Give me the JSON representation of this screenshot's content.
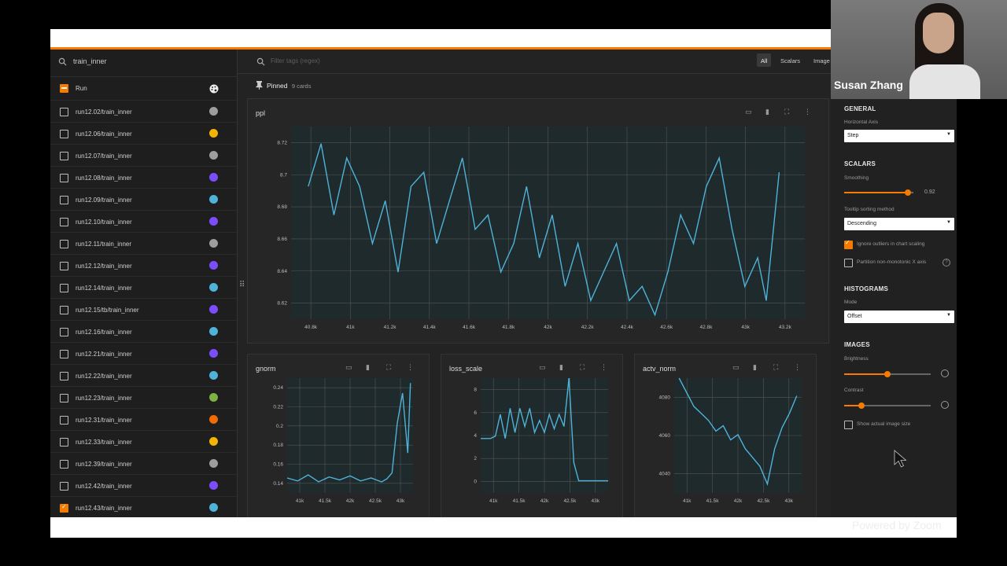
{
  "sidebar": {
    "search_value": "train_inner",
    "header_label": "Run",
    "runs": [
      {
        "label": "run12.02/train_inner",
        "color": "#9e9e9e",
        "checked": false
      },
      {
        "label": "run12.06/train_inner",
        "color": "#f4b400",
        "checked": false
      },
      {
        "label": "run12.07/train_inner",
        "color": "#9e9e9e",
        "checked": false
      },
      {
        "label": "run12.08/train_inner",
        "color": "#7c4dff",
        "checked": false
      },
      {
        "label": "run12.09/train_inner",
        "color": "#4fb3d9",
        "checked": false
      },
      {
        "label": "run12.10/train_inner",
        "color": "#7c4dff",
        "checked": false
      },
      {
        "label": "run12.11/train_inner",
        "color": "#9e9e9e",
        "checked": false
      },
      {
        "label": "run12.12/train_inner",
        "color": "#7c4dff",
        "checked": false
      },
      {
        "label": "run12.14/train_inner",
        "color": "#4fb3d9",
        "checked": false
      },
      {
        "label": "run12.15/tb/train_inner",
        "color": "#7c4dff",
        "checked": false
      },
      {
        "label": "run12.16/train_inner",
        "color": "#4fb3d9",
        "checked": false
      },
      {
        "label": "run12.21/train_inner",
        "color": "#7c4dff",
        "checked": false
      },
      {
        "label": "run12.22/train_inner",
        "color": "#4fb3d9",
        "checked": false
      },
      {
        "label": "run12.23/train_inner",
        "color": "#7cb342",
        "checked": false
      },
      {
        "label": "run12.31/train_inner",
        "color": "#ef6c00",
        "checked": false
      },
      {
        "label": "run12.33/train_inner",
        "color": "#f4b400",
        "checked": false
      },
      {
        "label": "run12.39/train_inner",
        "color": "#9e9e9e",
        "checked": false
      },
      {
        "label": "run12.42/train_inner",
        "color": "#7c4dff",
        "checked": false
      },
      {
        "label": "run12.43/train_inner",
        "color": "#4fb3d9",
        "checked": true
      }
    ]
  },
  "toolbar": {
    "filter_placeholder": "Filter tags (regex)",
    "tabs": [
      "All",
      "Scalars",
      "Image"
    ]
  },
  "pinned": {
    "label": "Pinned",
    "count": "9 cards"
  },
  "chart_data": [
    {
      "type": "line",
      "title": "ppl",
      "xticks": [
        "40.8k",
        "41k",
        "41.2k",
        "41.4k",
        "41.6k",
        "41.8k",
        "42k",
        "42.2k",
        "42.4k",
        "42.6k",
        "42.8k",
        "43k",
        "43.2k"
      ],
      "yticks": [
        "8.72",
        "8.7",
        "8.68",
        "8.66",
        "8.64",
        "8.62"
      ],
      "xlim": [
        40800,
        43200
      ],
      "ylim": [
        8.607,
        8.742
      ],
      "series": [
        {
          "color": "#4fb3d9",
          "x": [
            40880,
            40940,
            41000,
            41060,
            41120,
            41180,
            41240,
            41300,
            41360,
            41420,
            41480,
            41540,
            41600,
            41660,
            41720,
            41780,
            41840,
            41900,
            41960,
            42020,
            42080,
            42140,
            42200,
            42260,
            42320,
            42380,
            42440,
            42500,
            42560,
            42620,
            42680,
            42740,
            42800,
            42860,
            42920,
            42980,
            43020,
            43080
          ],
          "y": [
            8.7,
            8.73,
            8.68,
            8.72,
            8.7,
            8.66,
            8.69,
            8.64,
            8.7,
            8.71,
            8.66,
            8.69,
            8.72,
            8.67,
            8.68,
            8.64,
            8.66,
            8.7,
            8.65,
            8.68,
            8.63,
            8.66,
            8.62,
            8.64,
            8.66,
            8.62,
            8.63,
            8.61,
            8.64,
            8.68,
            8.66,
            8.7,
            8.72,
            8.67,
            8.63,
            8.65,
            8.62,
            8.71
          ]
        }
      ]
    },
    {
      "type": "line",
      "title": "gnorm",
      "xticks": [
        "41k",
        "41.5k",
        "42k",
        "42.5k",
        "43k"
      ],
      "yticks": [
        "0.24",
        "0.22",
        "0.2",
        "0.18",
        "0.16",
        "0.14"
      ],
      "xlim": [
        40800,
        43200
      ],
      "ylim": [
        0.13,
        0.245
      ],
      "series": [
        {
          "color": "#4fb3d9",
          "x": [
            40800,
            41000,
            41200,
            41400,
            41600,
            41800,
            42000,
            42200,
            42400,
            42600,
            42700,
            42800,
            42900,
            43000,
            43100,
            43150
          ],
          "y": [
            0.145,
            0.142,
            0.148,
            0.141,
            0.146,
            0.143,
            0.147,
            0.142,
            0.145,
            0.141,
            0.144,
            0.15,
            0.2,
            0.23,
            0.17,
            0.24
          ]
        }
      ]
    },
    {
      "type": "line",
      "title": "loss_scale",
      "xticks": [
        "41k",
        "41.5k",
        "42k",
        "42.5k",
        "43k"
      ],
      "yticks": [
        "8",
        "6",
        "4",
        "2",
        "0"
      ],
      "xlim": [
        40700,
        43300
      ],
      "ylim": [
        -0.5,
        9
      ],
      "series": [
        {
          "color": "#4fb3d9",
          "x": [
            40700,
            40900,
            41000,
            41100,
            41200,
            41300,
            41400,
            41500,
            41600,
            41700,
            41800,
            41900,
            42000,
            42100,
            42200,
            42300,
            42400,
            42500,
            42600,
            42700,
            42800,
            43000,
            43300
          ],
          "y": [
            4,
            4,
            4.2,
            6,
            4,
            6.5,
            4.5,
            6.5,
            5,
            6.5,
            4.5,
            5.5,
            4.5,
            6,
            4.8,
            6,
            5,
            9,
            2,
            0.5,
            0.5,
            0.5,
            0.5
          ]
        }
      ]
    },
    {
      "type": "line",
      "title": "actv_norm",
      "xticks": [
        "41k",
        "41.5k",
        "42k",
        "42.5k",
        "43k"
      ],
      "yticks": [
        "4080",
        "4060",
        "4040"
      ],
      "xlim": [
        40700,
        43300
      ],
      "ylim": [
        4025,
        4090
      ],
      "series": [
        {
          "color": "#4fb3d9",
          "x": [
            40800,
            40950,
            41100,
            41250,
            41400,
            41550,
            41700,
            41850,
            42000,
            42150,
            42300,
            42450,
            42600,
            42750,
            42900,
            43050,
            43200
          ],
          "y": [
            4090,
            4082,
            4074,
            4070,
            4066,
            4060,
            4063,
            4055,
            4058,
            4050,
            4045,
            4040,
            4030,
            4050,
            4062,
            4070,
            4080
          ]
        }
      ]
    }
  ],
  "settings": {
    "general_title": "GENERAL",
    "horizontal_axis_label": "Horizontal Axis",
    "horizontal_axis_value": "Step",
    "scalars_title": "SCALARS",
    "smoothing_label": "Smoothing",
    "smoothing_value": "0.92",
    "smoothing_level": 0.92,
    "tooltip_label": "Tooltip sorting method",
    "tooltip_value": "Descending",
    "ignore_outliers_label": "Ignore outliers in chart scaling",
    "partition_label": "Partition non-monotonic X axis",
    "histograms_title": "HISTOGRAMS",
    "mode_label": "Mode",
    "mode_value": "Offset",
    "images_title": "IMAGES",
    "brightness_label": "Brightness",
    "brightness_level": 0.5,
    "contrast_label": "Contrast",
    "contrast_level": 0.2,
    "show_actual_label": "Show actual image size"
  },
  "video": {
    "speaker": "Susan Zhang"
  },
  "zoom": {
    "powered": "Powered by Zoom"
  }
}
